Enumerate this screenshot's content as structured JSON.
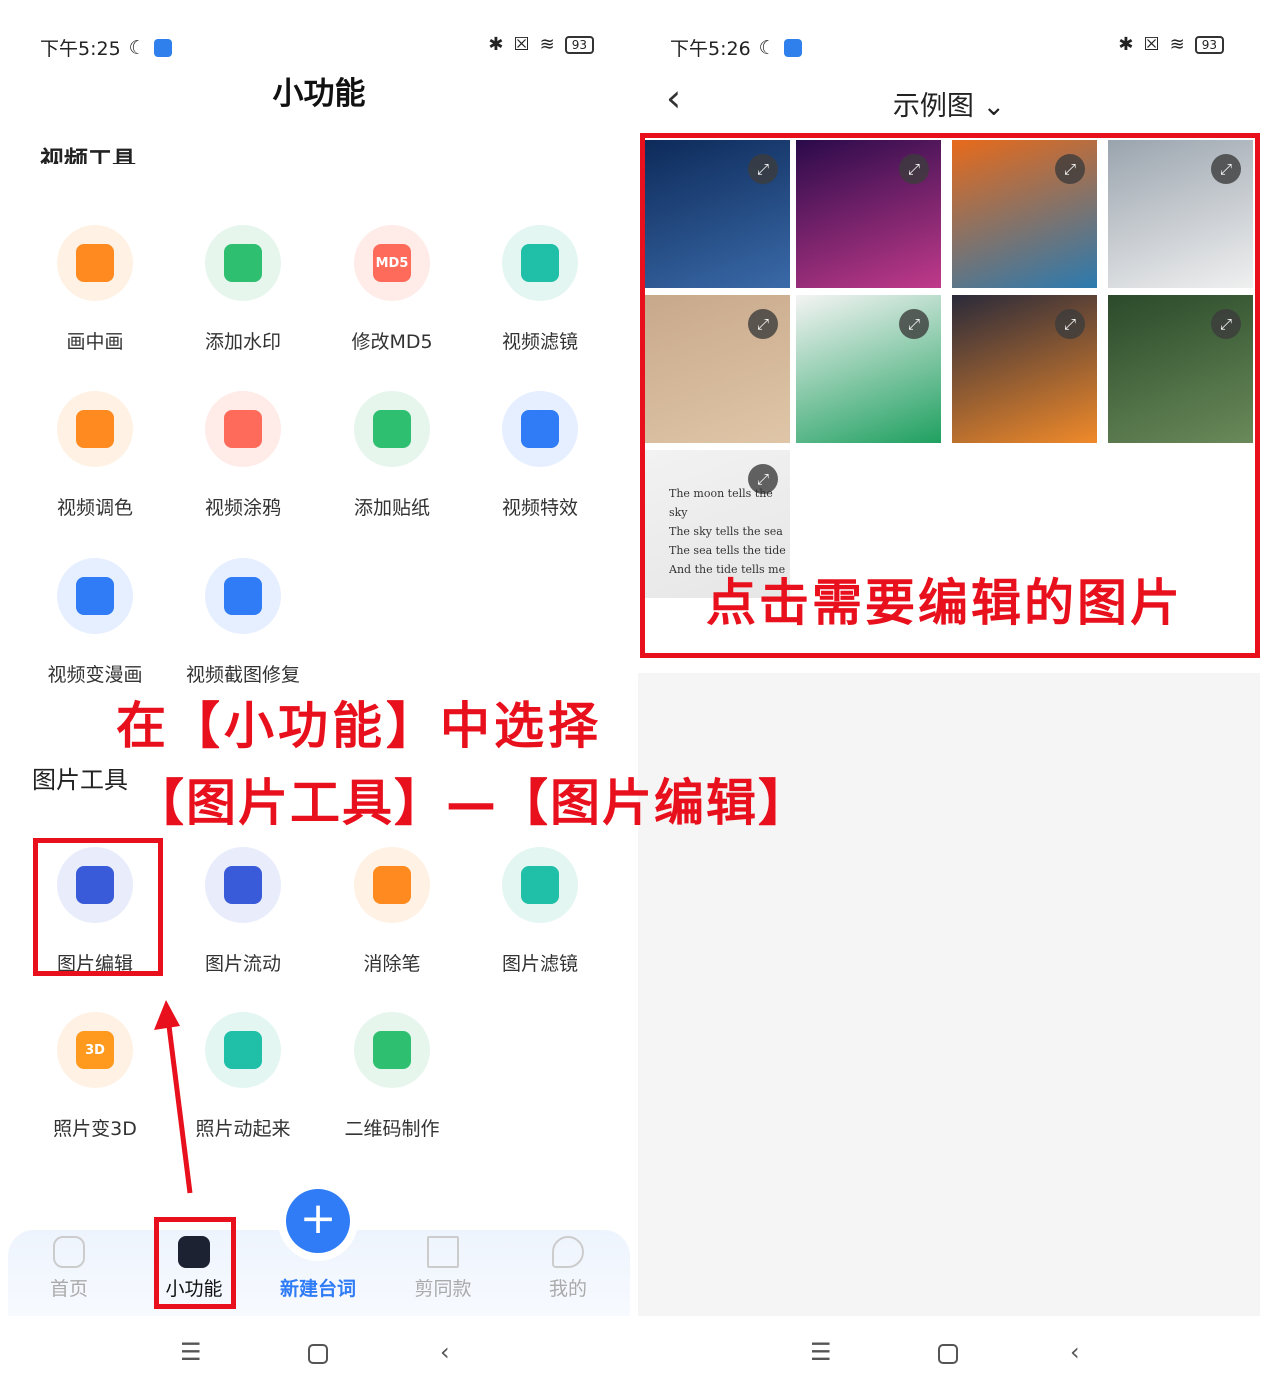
{
  "left": {
    "status": {
      "time": "下午5:25",
      "battery": "93"
    },
    "title": "小功能",
    "section_video": "视频工具",
    "video_tools": [
      {
        "label": "画中画",
        "icon": "picture-in-picture-icon",
        "color": "#ff8a1f",
        "bg": "#fff1e3"
      },
      {
        "label": "添加水印",
        "icon": "watermark-icon",
        "color": "#2fbf71",
        "bg": "#e6f6ec"
      },
      {
        "label": "修改MD5",
        "icon": "md5-icon",
        "color": "#ff6b5a",
        "bg": "#ffebe8",
        "text": "MD5"
      },
      {
        "label": "视频滤镜",
        "icon": "filter-icon",
        "color": "#1fbfa8",
        "bg": "#e3f6f2"
      },
      {
        "label": "视频调色",
        "icon": "palette-icon",
        "color": "#ff8a1f",
        "bg": "#fff1e3"
      },
      {
        "label": "视频涂鸦",
        "icon": "graffiti-icon",
        "color": "#ff6b5a",
        "bg": "#ffebe8"
      },
      {
        "label": "添加贴纸",
        "icon": "sticker-icon",
        "color": "#2fbf71",
        "bg": "#e6f6ec"
      },
      {
        "label": "视频特效",
        "icon": "effects-icon",
        "color": "#2f7cf6",
        "bg": "#e6efff"
      },
      {
        "label": "视频变漫画",
        "icon": "cartoon-icon",
        "color": "#2f7cf6",
        "bg": "#e6efff"
      },
      {
        "label": "视频截图修复",
        "icon": "image-repair-icon",
        "color": "#2f7cf6",
        "bg": "#e6efff"
      }
    ],
    "section_image": "图片工具",
    "image_tools": [
      {
        "label": "图片编辑",
        "icon": "image-edit-icon",
        "color": "#3a5bd9",
        "bg": "#e8ecfb"
      },
      {
        "label": "图片流动",
        "icon": "image-flow-icon",
        "color": "#3a5bd9",
        "bg": "#e8ecfb"
      },
      {
        "label": "消除笔",
        "icon": "eraser-icon",
        "color": "#ff8a1f",
        "bg": "#fff1e3"
      },
      {
        "label": "图片滤镜",
        "icon": "image-filter-icon",
        "color": "#1fbfa8",
        "bg": "#e3f6f2"
      },
      {
        "label": "照片变3D",
        "icon": "3d-cube-icon",
        "color": "#ff9a1f",
        "bg": "#fff1e3",
        "text": "3D"
      },
      {
        "label": "照片动起来",
        "icon": "animate-photo-icon",
        "color": "#1fbfa8",
        "bg": "#e3f6f2"
      },
      {
        "label": "二维码制作",
        "icon": "qrcode-icon",
        "color": "#2fbf71",
        "bg": "#e6f6ec"
      }
    ],
    "annotation_line1": "在【小功能】中选择",
    "annotation_line2": "【图片工具】—【图片编辑】",
    "bottom_nav": [
      {
        "label": "首页",
        "icon": "home-icon"
      },
      {
        "label": "小功能",
        "icon": "tools-hexagon-icon",
        "active": true
      },
      {
        "label": "新建台词",
        "icon": "plus-icon"
      },
      {
        "label": "剪同款",
        "icon": "crop-video-icon"
      },
      {
        "label": "我的",
        "icon": "profile-icon"
      }
    ]
  },
  "right": {
    "status": {
      "time": "下午5:26",
      "battery": "93"
    },
    "title": "示例图",
    "photos": [
      {
        "desc": "night-sky-cloud",
        "colors": [
          "#0d2a5a",
          "#3a6aa8"
        ]
      },
      {
        "desc": "city-night",
        "colors": [
          "#2a0a4a",
          "#c03a8a"
        ]
      },
      {
        "desc": "abstract-paint",
        "colors": [
          "#e86a1a",
          "#2a7ab0"
        ]
      },
      {
        "desc": "city-fog",
        "colors": [
          "#9aa4ae",
          "#f0f0f0"
        ]
      },
      {
        "desc": "woman-pink-coat",
        "colors": [
          "#c8a88a",
          "#e0c6a8"
        ]
      },
      {
        "desc": "man-green-shirt",
        "colors": [
          "#f4f4f4",
          "#1fa060"
        ]
      },
      {
        "desc": "sunset-sea",
        "colors": [
          "#2a2a3a",
          "#f08a2a"
        ]
      },
      {
        "desc": "woman-portrait",
        "colors": [
          "#2a4a2a",
          "#6a8a5a"
        ]
      },
      {
        "desc": "text-poster",
        "colors": [
          "#f2f2f2",
          "#e6e6e6"
        ]
      }
    ],
    "poster_text": [
      "The moon tells the sky",
      "The sky tells the sea",
      "The sea tells the tide",
      "And the tide tells me"
    ],
    "annotation": "点击需要编辑的图片"
  },
  "colors": {
    "accent": "#2f7cf6",
    "annotation": "#e8101c"
  }
}
